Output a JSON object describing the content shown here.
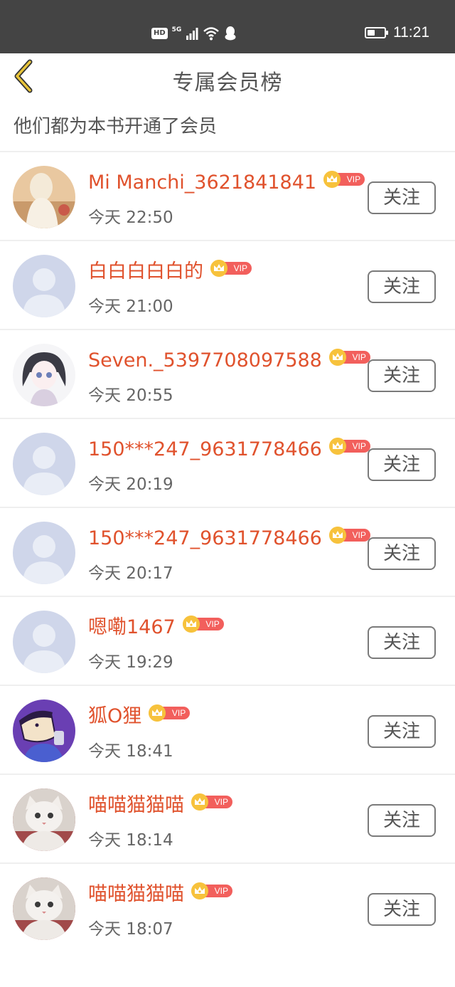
{
  "status_bar": {
    "hd": "HD",
    "network": "5G",
    "time": "11:21",
    "battery_level": 0.45
  },
  "header": {
    "back_icon": "chevron-left-icon",
    "title": "专属会员榜",
    "accent_color": "#e8c43a"
  },
  "subtitle": "他们都为本书开通了会员",
  "vip_label": "VIP",
  "follow_label": "关注",
  "members": [
    {
      "name": "Mi Manchi_3621841841",
      "time": "今天 22:50",
      "avatar": "photo-girl"
    },
    {
      "name": "白白白白白的",
      "time": "今天 21:00",
      "avatar": "default-person"
    },
    {
      "name": "Seven._5397708097588",
      "time": "今天 20:55",
      "avatar": "anime-girl"
    },
    {
      "name": "150***247_9631778466",
      "time": "今天 20:19",
      "avatar": "default-person"
    },
    {
      "name": "150***247_9631778466",
      "time": "今天 20:17",
      "avatar": "default-person"
    },
    {
      "name": "嗯嘞1467",
      "time": "今天 19:29",
      "avatar": "default-person"
    },
    {
      "name": "狐O狸",
      "time": "今天 18:41",
      "avatar": "cartoon-purple"
    },
    {
      "name": "喵喵猫猫喵",
      "time": "今天 18:14",
      "avatar": "white-cat"
    },
    {
      "name": "喵喵猫猫喵",
      "time": "今天 18:07",
      "avatar": "white-cat"
    }
  ]
}
